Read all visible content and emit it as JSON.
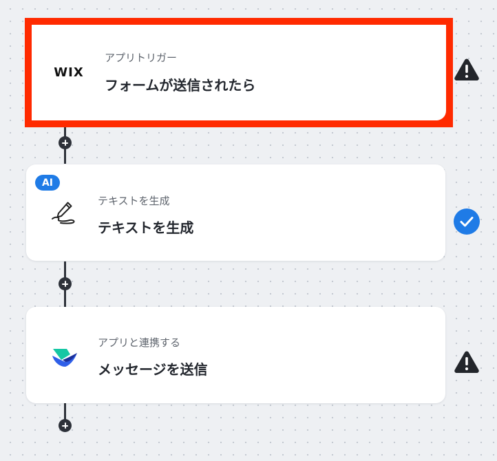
{
  "steps": [
    {
      "type_label": "アプリトリガー",
      "title": "フォームが送信されたら",
      "app_logo_text": "WIX",
      "app_icon": "wix-logo",
      "status": "warning",
      "status_icon": "warning-icon",
      "selected": true
    },
    {
      "type_label": "テキストを生成",
      "title": "テキストを生成",
      "badge": "AI",
      "app_icon": "pen-scribble-icon",
      "status": "complete",
      "status_icon": "check-circle-icon",
      "selected": false
    },
    {
      "type_label": "アプリと連携する",
      "title": "メッセージを送信",
      "app_icon": "lark-logo-icon",
      "status": "warning",
      "status_icon": "warning-icon",
      "selected": false
    }
  ],
  "colors": {
    "selection_border": "#ff2a00",
    "ai_badge": "#1f7be6",
    "status_complete": "#1f7be6",
    "status_warning": "#23262b",
    "connector": "#2d3139"
  }
}
